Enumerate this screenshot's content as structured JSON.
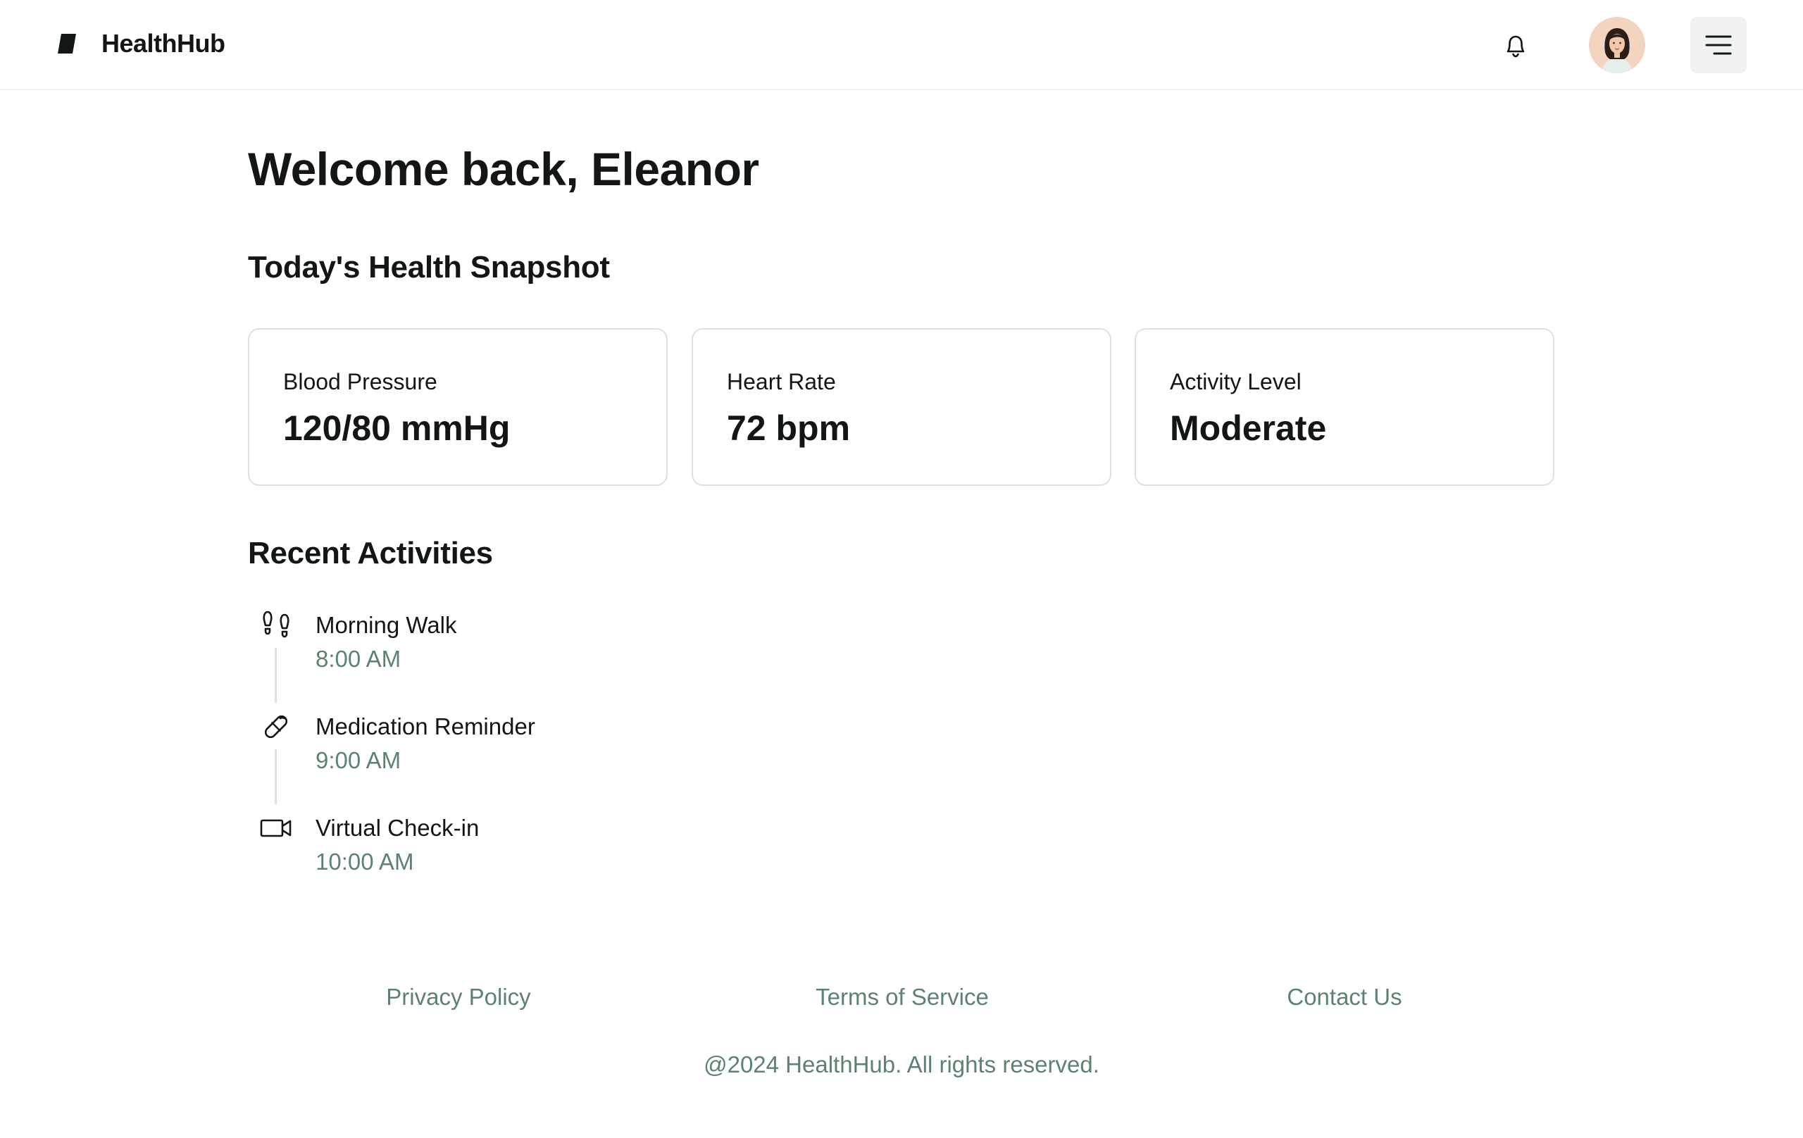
{
  "header": {
    "brand": "HealthHub",
    "logo_icon": "logo-icon",
    "notifications_icon": "bell-icon",
    "menu_icon": "menu-icon"
  },
  "main": {
    "welcome": "Welcome back, Eleanor",
    "snapshot_title": "Today's Health Snapshot",
    "cards": [
      {
        "label": "Blood Pressure",
        "value": "120/80 mmHg"
      },
      {
        "label": "Heart Rate",
        "value": "72 bpm"
      },
      {
        "label": "Activity Level",
        "value": "Moderate"
      }
    ],
    "activities_title": "Recent Activities",
    "activities": [
      {
        "name": "Morning Walk",
        "time": "8:00 AM",
        "icon": "footprints-icon"
      },
      {
        "name": "Medication Reminder",
        "time": "9:00 AM",
        "icon": "pill-icon"
      },
      {
        "name": "Virtual Check-in",
        "time": "10:00 AM",
        "icon": "video-camera-icon"
      }
    ]
  },
  "footer": {
    "links": [
      "Privacy Policy",
      "Terms of Service",
      "Contact Us"
    ],
    "copyright": "@2024 HealthHub. All rights reserved."
  },
  "colors": {
    "text": "#121714",
    "muted_green": "#5e8270",
    "border": "#dde0e3",
    "menu_button_bg": "#eff1f3"
  }
}
